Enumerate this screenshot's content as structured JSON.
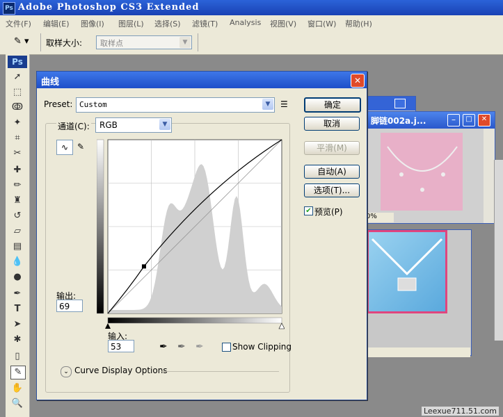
{
  "app": {
    "title": "Adobe Photoshop CS3 Extended",
    "logo": "Ps"
  },
  "menu": [
    "文件(F)",
    "编辑(E)",
    "图像(I)",
    "图层(L)",
    "选择(S)",
    "滤镜(T)",
    "Analysis",
    "视图(V)",
    "窗口(W)",
    "帮助(H)"
  ],
  "options": {
    "label": "取样大小:",
    "value": "取样点"
  },
  "toolbox": {
    "logo": "Ps"
  },
  "doc1": {
    "title": "脚链002a.j..."
  },
  "doc2": {
    "zoom": "0%"
  },
  "dialog": {
    "title": "曲线",
    "preset_label": "Preset:",
    "preset_value": "Custom",
    "channel_label": "通道(C):",
    "channel_value": "RGB",
    "buttons": {
      "ok": "确定",
      "cancel": "取消",
      "smooth": "平滑(M)",
      "auto": "自动(A)",
      "options": "选项(T)..."
    },
    "preview_label": "预览(P)",
    "preview_checked": true,
    "output_label": "输出:",
    "output_value": "69",
    "input_label": "输入:",
    "input_value": "53",
    "show_clipping_label": "Show Clipping",
    "curve_display_label": "Curve Display Options"
  },
  "chart_data": {
    "type": "line",
    "title": "",
    "xlim": [
      0,
      255
    ],
    "ylim": [
      0,
      255
    ],
    "series": [
      {
        "values": [
          [
            0,
            0
          ],
          [
            53,
            69
          ],
          [
            255,
            255
          ]
        ]
      }
    ],
    "histogram_note": "luminance histogram shown behind the curve"
  },
  "watermark": "Leexue711.51.com",
  "colors": {
    "title_blue": "#1e4fc9",
    "close_red": "#e04a2a",
    "dialog_bg": "#ece9d8"
  }
}
